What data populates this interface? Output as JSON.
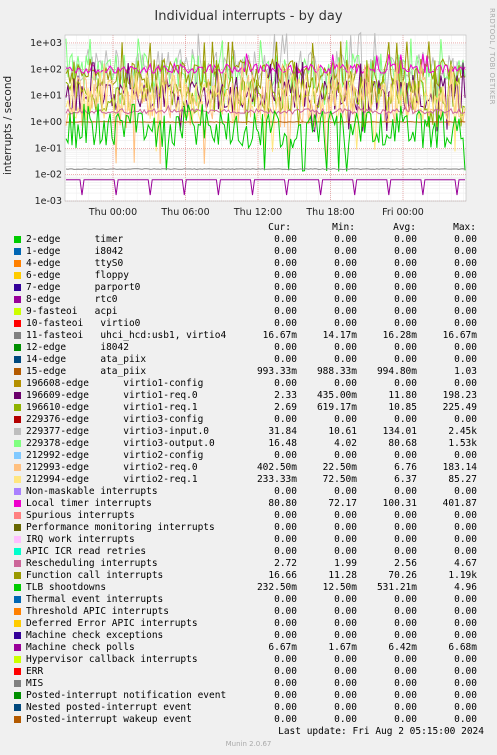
{
  "side_text": "RRDTOOL / TOBI OETIKER",
  "footer": {
    "last_update": "Last update: Fri Aug  2 05:15:00 2024",
    "munin": "Munin 2.0.67"
  },
  "legend_headers": {
    "cur": "Cur:",
    "min": "Min:",
    "avg": "Avg:",
    "max": "Max:"
  },
  "chart_data": {
    "type": "line",
    "title": "Individual interrupts - by day",
    "ylabel": "interrupts / second",
    "yscale": "log",
    "ylim": [
      0.001,
      2000
    ],
    "yticks": [
      "1e-03",
      "1e-02",
      "1e-01",
      "1e+00",
      "1e+01",
      "1e+02",
      "1e+03"
    ],
    "xticks": [
      "Thu 00:00",
      "Thu 06:00",
      "Thu 12:00",
      "Thu 18:00",
      "Fri 00:00"
    ],
    "series": [
      {
        "name": "2-edge      timer",
        "color": "#00cc00",
        "cur": "0.00",
        "min": "0.00",
        "avg": "0.00",
        "max": "0.00"
      },
      {
        "name": "1-edge      i8042",
        "color": "#0066b3",
        "cur": "0.00",
        "min": "0.00",
        "avg": "0.00",
        "max": "0.00"
      },
      {
        "name": "4-edge      ttyS0",
        "color": "#ff8000",
        "cur": "0.00",
        "min": "0.00",
        "avg": "0.00",
        "max": "0.00"
      },
      {
        "name": "6-edge      floppy",
        "color": "#ffcc00",
        "cur": "0.00",
        "min": "0.00",
        "avg": "0.00",
        "max": "0.00"
      },
      {
        "name": "7-edge      parport0",
        "color": "#330099",
        "cur": "0.00",
        "min": "0.00",
        "avg": "0.00",
        "max": "0.00"
      },
      {
        "name": "8-edge      rtc0",
        "color": "#990099",
        "cur": "0.00",
        "min": "0.00",
        "avg": "0.00",
        "max": "0.00"
      },
      {
        "name": "9-fasteoi   acpi",
        "color": "#ccff00",
        "cur": "0.00",
        "min": "0.00",
        "avg": "0.00",
        "max": "0.00"
      },
      {
        "name": "10-fasteoi   virtio0",
        "color": "#ff0000",
        "cur": "0.00",
        "min": "0.00",
        "avg": "0.00",
        "max": "0.00"
      },
      {
        "name": "11-fasteoi   uhci_hcd:usb1, virtio4",
        "color": "#808080",
        "cur": "16.67m",
        "min": "14.17m",
        "avg": "16.28m",
        "max": "16.67m"
      },
      {
        "name": "12-edge      i8042",
        "color": "#008f00",
        "cur": "0.00",
        "min": "0.00",
        "avg": "0.00",
        "max": "0.00"
      },
      {
        "name": "14-edge      ata_piix",
        "color": "#00487d",
        "cur": "0.00",
        "min": "0.00",
        "avg": "0.00",
        "max": "0.00"
      },
      {
        "name": "15-edge      ata_piix",
        "color": "#b35a00",
        "cur": "993.33m",
        "min": "988.33m",
        "avg": "994.80m",
        "max": "1.03"
      },
      {
        "name": "196608-edge      virtio1-config",
        "color": "#b38f00",
        "cur": "0.00",
        "min": "0.00",
        "avg": "0.00",
        "max": "0.00"
      },
      {
        "name": "196609-edge      virtio1-req.0",
        "color": "#6b006b",
        "cur": "2.33",
        "min": "435.00m",
        "avg": "11.80",
        "max": "198.23"
      },
      {
        "name": "196610-edge      virtio1-req.1",
        "color": "#8fb300",
        "cur": "2.69",
        "min": "619.17m",
        "avg": "10.85",
        "max": "225.49"
      },
      {
        "name": "229376-edge      virtio3-config",
        "color": "#b30000",
        "cur": "0.00",
        "min": "0.00",
        "avg": "0.00",
        "max": "0.00"
      },
      {
        "name": "229377-edge      virtio3-input.0",
        "color": "#bebebe",
        "cur": "31.84",
        "min": "10.61",
        "avg": "134.01",
        "max": "2.45k"
      },
      {
        "name": "229378-edge      virtio3-output.0",
        "color": "#80ff80",
        "cur": "16.48",
        "min": "4.02",
        "avg": "80.68",
        "max": "1.53k"
      },
      {
        "name": "212992-edge      virtio2-config",
        "color": "#80c9ff",
        "cur": "0.00",
        "min": "0.00",
        "avg": "0.00",
        "max": "0.00"
      },
      {
        "name": "212993-edge      virtio2-req.0",
        "color": "#ffc080",
        "cur": "402.50m",
        "min": "22.50m",
        "avg": "6.76",
        "max": "183.14"
      },
      {
        "name": "212994-edge      virtio2-req.1",
        "color": "#ffe680",
        "cur": "233.33m",
        "min": "72.50m",
        "avg": "6.37",
        "max": "85.27"
      },
      {
        "name": "Non-maskable interrupts",
        "color": "#aa80ff",
        "cur": "0.00",
        "min": "0.00",
        "avg": "0.00",
        "max": "0.00"
      },
      {
        "name": "Local timer interrupts",
        "color": "#ee00cc",
        "cur": "80.80",
        "min": "72.17",
        "avg": "100.31",
        "max": "401.87"
      },
      {
        "name": "Spurious interrupts",
        "color": "#ff8080",
        "cur": "0.00",
        "min": "0.00",
        "avg": "0.00",
        "max": "0.00"
      },
      {
        "name": "Performance monitoring interrupts",
        "color": "#666600",
        "cur": "0.00",
        "min": "0.00",
        "avg": "0.00",
        "max": "0.00"
      },
      {
        "name": "IRQ work interrupts",
        "color": "#ffbfff",
        "cur": "0.00",
        "min": "0.00",
        "avg": "0.00",
        "max": "0.00"
      },
      {
        "name": "APIC ICR read retries",
        "color": "#00ffcc",
        "cur": "0.00",
        "min": "0.00",
        "avg": "0.00",
        "max": "0.00"
      },
      {
        "name": "Rescheduling interrupts",
        "color": "#cc6699",
        "cur": "2.72",
        "min": "1.99",
        "avg": "2.56",
        "max": "4.67"
      },
      {
        "name": "Function call interrupts",
        "color": "#999900",
        "cur": "16.66",
        "min": "11.28",
        "avg": "70.26",
        "max": "1.19k"
      },
      {
        "name": "TLB shootdowns",
        "color": "#00cc00",
        "cur": "232.50m",
        "min": "12.50m",
        "avg": "531.21m",
        "max": "4.96"
      },
      {
        "name": "Thermal event interrupts",
        "color": "#0066b3",
        "cur": "0.00",
        "min": "0.00",
        "avg": "0.00",
        "max": "0.00"
      },
      {
        "name": "Threshold APIC interrupts",
        "color": "#ff8000",
        "cur": "0.00",
        "min": "0.00",
        "avg": "0.00",
        "max": "0.00"
      },
      {
        "name": "Deferred Error APIC interrupts",
        "color": "#ffcc00",
        "cur": "0.00",
        "min": "0.00",
        "avg": "0.00",
        "max": "0.00"
      },
      {
        "name": "Machine check exceptions",
        "color": "#330099",
        "cur": "0.00",
        "min": "0.00",
        "avg": "0.00",
        "max": "0.00"
      },
      {
        "name": "Machine check polls",
        "color": "#990099",
        "cur": "6.67m",
        "min": "1.67m",
        "avg": "6.42m",
        "max": "6.68m"
      },
      {
        "name": "Hypervisor callback interrupts",
        "color": "#ccff00",
        "cur": "0.00",
        "min": "0.00",
        "avg": "0.00",
        "max": "0.00"
      },
      {
        "name": "ERR",
        "color": "#ff0000",
        "cur": "0.00",
        "min": "0.00",
        "avg": "0.00",
        "max": "0.00"
      },
      {
        "name": "MIS",
        "color": "#808080",
        "cur": "0.00",
        "min": "0.00",
        "avg": "0.00",
        "max": "0.00"
      },
      {
        "name": "Posted-interrupt notification event",
        "color": "#008f00",
        "cur": "0.00",
        "min": "0.00",
        "avg": "0.00",
        "max": "0.00"
      },
      {
        "name": "Nested posted-interrupt event",
        "color": "#00487d",
        "cur": "0.00",
        "min": "0.00",
        "avg": "0.00",
        "max": "0.00"
      },
      {
        "name": "Posted-interrupt wakeup event",
        "color": "#b35a00",
        "cur": "0.00",
        "min": "0.00",
        "avg": "0.00",
        "max": "0.00"
      }
    ]
  }
}
